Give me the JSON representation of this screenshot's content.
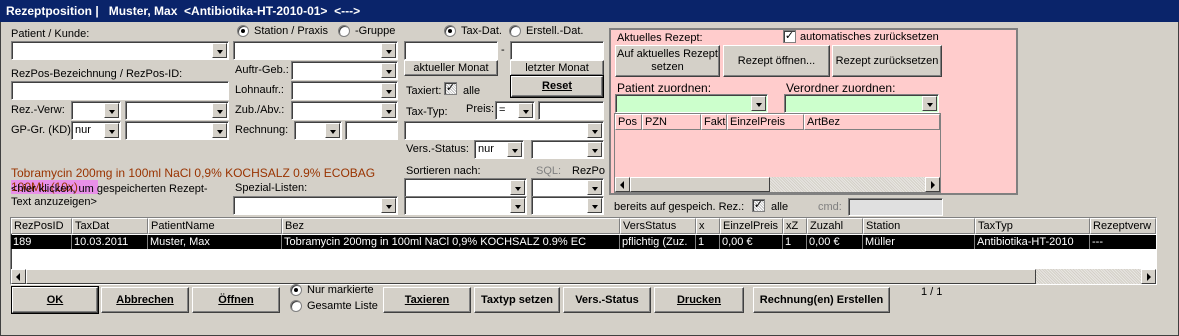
{
  "titlebar": {
    "title": "Rezeptposition |   Muster, Max  <Antibiotika-HT-2010-01>  <--->"
  },
  "left": {
    "patient_label": "Patient / Kunde:",
    "rezpos_label": "RezPos-Bezeichnung / RezPos-ID:",
    "rezverw_label": "Rez.-Verw:",
    "gpgr_label": "GP-Gr. (KD)",
    "gpgr_value": "nur",
    "rezept_text_main": "Tobramycin 200mg in 100ml NaCl 0,9% KOCHSALZ 0.9% ECOBAG",
    "rezept_text_line2a": "100ML",
    "rezept_text_line2b": " (10x)",
    "hint": "<hier klicken, um gespeicherten Rezept-Text anzuzeigen>"
  },
  "station": {
    "radio_station": "Station / Praxis",
    "radio_gruppe": "-Gruppe",
    "auftr_label": "Auftr-Geb.:",
    "lohn_label": "Lohnaufr.:",
    "zub_label": "Zub./Abv.:",
    "rechnung_label": "Rechnung:",
    "spezial_label": "Spezial-Listen:"
  },
  "tax": {
    "radio_taxdat": "Tax-Dat.",
    "radio_erstell": "Erstell.-Dat.",
    "dash": "-",
    "aktueller_monat": "aktueller Monat",
    "letzter_monat": "letzter Monat",
    "reset": "Reset",
    "taxiert_label": "Taxiert:",
    "alle_label": "alle",
    "taxtyp_label": "Tax-Typ:",
    "preis_label": "Preis:",
    "preis_op": "=",
    "versstatus_label": "Vers.-Status:",
    "versstatus_value": "nur",
    "sortieren_label": "Sortieren nach:",
    "sql_label": "SQL:",
    "rezpo_label": "RezPo"
  },
  "aktuell": {
    "title": "Aktuelles Rezept:",
    "auto_reset_label": "automatisches zurücksetzen",
    "btn_setzen": "Auf aktuelles Rezept setzen",
    "btn_oeffnen": "Rezept öffnen...",
    "btn_zurueck": "Rezept zurücksetzen",
    "patient_zuordnen": "Patient zuordnen:",
    "verordner_zuordnen": "Verordner zuordnen:",
    "cols": [
      "Pos",
      "PZN",
      "Fakto",
      "EinzelPreis",
      "ArtBez"
    ],
    "bereits_label": "bereits auf gespeich. Rez.:",
    "bereits_alle": "alle",
    "cmd_label": "cmd:"
  },
  "table": {
    "columns": [
      "RezPosID",
      "TaxDat",
      "PatientName",
      "Bez",
      "VersStatus",
      "x",
      "EinzelPreis",
      "xZ",
      "Zuzahl",
      "Station",
      "TaxTyp",
      "Rezeptverw"
    ],
    "rows": [
      [
        "189",
        "10.03.2011",
        "Muster, Max",
        "Tobramycin 200mg in 100ml NaCl 0,9% KOCHSALZ 0.9% EC",
        "pflichtig (Zuz.",
        "1",
        "0,00 €",
        "1",
        "0,00 €",
        "Müller",
        "Antibiotika-HT-2010",
        "---"
      ]
    ]
  },
  "bottom": {
    "ok": "OK",
    "abbrechen": "Abbrechen",
    "oeffnen": "Öffnen",
    "nur_markierte": "Nur markierte",
    "gesamte_liste": "Gesamte Liste",
    "taxieren": "Taxieren",
    "taxtyp_setzen": "Taxtyp setzen",
    "vers_status": "Vers.-Status",
    "drucken": "Drucken",
    "rechnung_erstellen": "Rechnung(en) Erstellen",
    "paging": "1 / 1"
  }
}
